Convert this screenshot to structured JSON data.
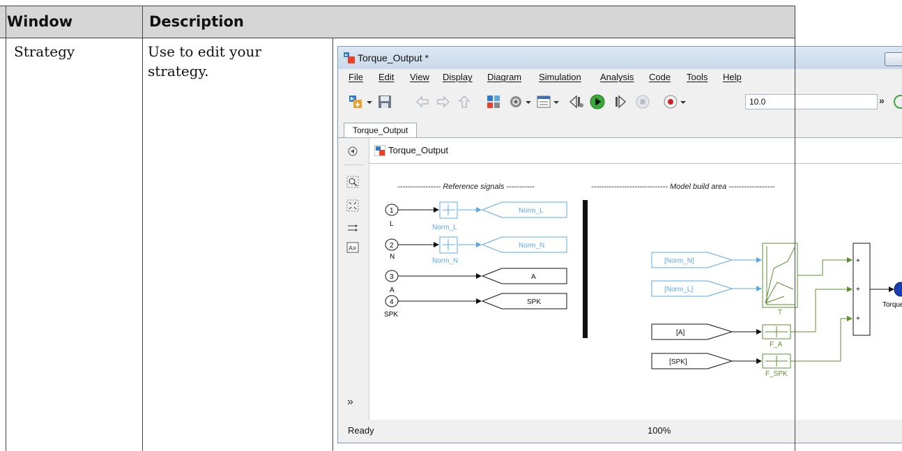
{
  "table": {
    "headers": [
      "Window",
      "Description"
    ],
    "row": {
      "window": "Strategy",
      "description": "Use to edit your strategy."
    }
  },
  "app_window": {
    "title": "Torque_Output *",
    "menu": [
      "File",
      "Edit",
      "View",
      "Display",
      "Diagram",
      "Simulation",
      "Analysis",
      "Code",
      "Tools",
      "Help"
    ],
    "stop_time": "10.0",
    "tab": "Torque_Output",
    "breadcrumb": "Torque_Output",
    "status": "Ready",
    "zoom": "100%",
    "toolbar_icons": [
      "new-model-icon",
      "save-icon",
      "back-icon",
      "forward-icon",
      "up-icon",
      "library-browser-icon",
      "model-settings-icon",
      "model-explorer-icon",
      "step-back-icon",
      "run-icon",
      "step-forward-icon",
      "stop-icon",
      "record-icon",
      "more-icon"
    ],
    "palette_icons": [
      "hide-browser-icon",
      "zoom-icon",
      "fit-view-icon",
      "route-lines-icon",
      "annotation-icon",
      "expand-palette-icon"
    ]
  },
  "diagram": {
    "ref_header": "----------------- Reference signals -----------",
    "build_header": "------------------------------ Model build area ------------------",
    "inports": [
      {
        "num": "1",
        "name": "L"
      },
      {
        "num": "2",
        "name": "N"
      },
      {
        "num": "3",
        "name": "A"
      },
      {
        "num": "4",
        "name": "SPK"
      }
    ],
    "norm_blocks": [
      "Norm_L",
      "Norm_N"
    ],
    "goto_tags": [
      "Norm_L",
      "Norm_N",
      "A",
      "SPK"
    ],
    "from_tags": [
      "[Norm_N]",
      "[Norm_L]",
      "[A]",
      "[SPK]"
    ],
    "table_block": "T",
    "func_blocks": [
      "F_A",
      "F_SPK"
    ],
    "sum_signs": [
      "+",
      "+",
      "+"
    ],
    "outport": "Torque"
  },
  "colors": {
    "header_bg": "#d6d6d6",
    "signal_blue": "#5aa8e8",
    "signal_green": "#5e8f2e",
    "run_green": "#3aa83a"
  }
}
